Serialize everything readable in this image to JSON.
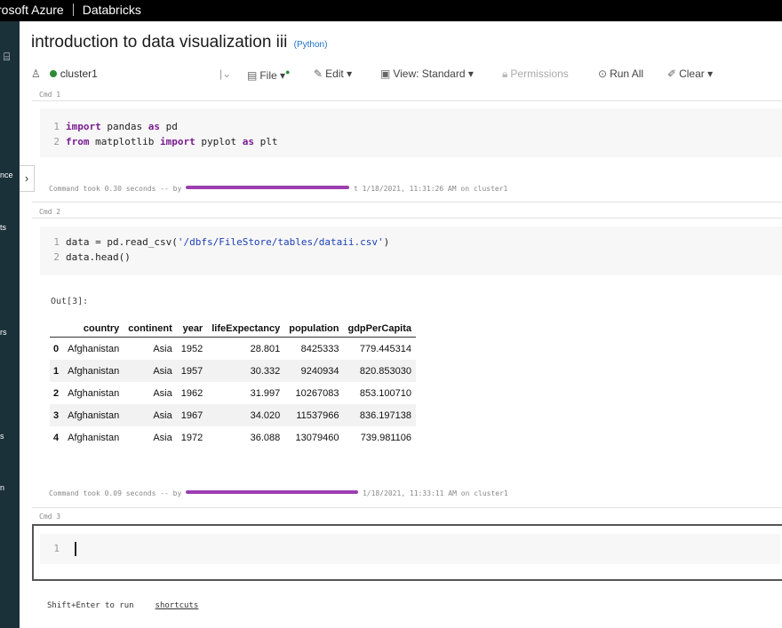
{
  "header": {
    "brand_left": "rosoft Azure",
    "brand_right": "Databricks"
  },
  "sidebar": {
    "fragments": [
      "nce",
      "ts",
      "rs",
      "s",
      "n"
    ]
  },
  "notebook": {
    "title": "introduction to data visualization iii",
    "language": "(Python)"
  },
  "toolbar": {
    "cluster": "cluster1",
    "file": "File",
    "edit": "Edit",
    "view": "View: Standard",
    "permissions": "Permissions",
    "run_all": "Run All",
    "clear": "Clear"
  },
  "cells": [
    {
      "cmd": "Cmd 1",
      "lines": [
        {
          "n": "1",
          "parts": [
            {
              "t": "import",
              "c": "kw"
            },
            {
              "t": " pandas "
            },
            {
              "t": "as",
              "c": "kw"
            },
            {
              "t": " pd"
            }
          ]
        },
        {
          "n": "2",
          "parts": [
            {
              "t": "from",
              "c": "kw"
            },
            {
              "t": " matplotlib "
            },
            {
              "t": "import",
              "c": "kw"
            },
            {
              "t": " pyplot "
            },
            {
              "t": "as",
              "c": "kw"
            },
            {
              "t": " plt"
            }
          ]
        }
      ],
      "took_prefix": "Command took 0.30 seconds -- by",
      "took_suffix": "t 1/18/2021, 11:31:26 AM on cluster1"
    },
    {
      "cmd": "Cmd 2",
      "lines": [
        {
          "n": "1",
          "parts": [
            {
              "t": "data = pd.read_csv("
            },
            {
              "t": "'/dbfs/FileStore/tables/dataii.csv'",
              "c": "str"
            },
            {
              "t": ")"
            }
          ]
        },
        {
          "n": "2",
          "parts": [
            {
              "t": "data.head()"
            }
          ]
        }
      ],
      "output_label": "Out[3]:",
      "table": {
        "columns": [
          "",
          "country",
          "continent",
          "year",
          "lifeExpectancy",
          "population",
          "gdpPerCapita"
        ],
        "rows": [
          [
            "0",
            "Afghanistan",
            "Asia",
            "1952",
            "28.801",
            "8425333",
            "779.445314"
          ],
          [
            "1",
            "Afghanistan",
            "Asia",
            "1957",
            "30.332",
            "9240934",
            "820.853030"
          ],
          [
            "2",
            "Afghanistan",
            "Asia",
            "1962",
            "31.997",
            "10267083",
            "853.100710"
          ],
          [
            "3",
            "Afghanistan",
            "Asia",
            "1967",
            "34.020",
            "11537966",
            "836.197138"
          ],
          [
            "4",
            "Afghanistan",
            "Asia",
            "1972",
            "36.088",
            "13079460",
            "739.981106"
          ]
        ]
      },
      "took_prefix": "Command took 0.09 seconds -- by",
      "took_suffix": "1/18/2021, 11:33:11 AM on cluster1"
    },
    {
      "cmd": "Cmd 3",
      "lines": [
        {
          "n": "1",
          "parts": []
        }
      ]
    }
  ],
  "footer": {
    "hint": "Shift+Enter to run",
    "shortcuts": "shortcuts"
  }
}
